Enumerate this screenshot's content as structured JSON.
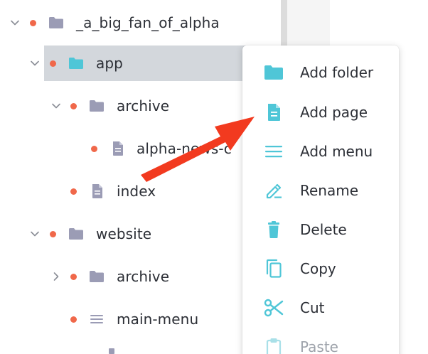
{
  "colors": {
    "dot": "#f0684a",
    "folder_gray": "#9b9cb5",
    "folder_teal": "#4fc6d7",
    "menu_accent": "#4fc6d7",
    "arrow": "#f23a1f",
    "selected_row": "#d3d7dc"
  },
  "tree": {
    "items": [
      {
        "label": "_a_big_fan_of_alpha",
        "icon": "folder-icon"
      },
      {
        "label": "app",
        "icon": "folder-icon"
      },
      {
        "label": "archive",
        "icon": "folder-icon"
      },
      {
        "label": "alpha-news-c",
        "icon": "page-icon"
      },
      {
        "label": "index",
        "icon": "page-icon"
      },
      {
        "label": "website",
        "icon": "folder-icon"
      },
      {
        "label": "archive",
        "icon": "folder-icon"
      },
      {
        "label": "main-menu",
        "icon": "menu-icon"
      }
    ]
  },
  "context_menu": {
    "items": [
      {
        "label": "Add folder",
        "icon": "folder-icon",
        "enabled": true
      },
      {
        "label": "Add page",
        "icon": "page-icon",
        "enabled": true
      },
      {
        "label": "Add menu",
        "icon": "menu-icon",
        "enabled": true
      },
      {
        "label": "Rename",
        "icon": "pencil-icon",
        "enabled": true
      },
      {
        "label": "Delete",
        "icon": "trash-icon",
        "enabled": true
      },
      {
        "label": "Copy",
        "icon": "copy-icon",
        "enabled": true
      },
      {
        "label": "Cut",
        "icon": "scissors-icon",
        "enabled": true
      },
      {
        "label": "Paste",
        "icon": "clipboard-icon",
        "enabled": false
      }
    ]
  }
}
